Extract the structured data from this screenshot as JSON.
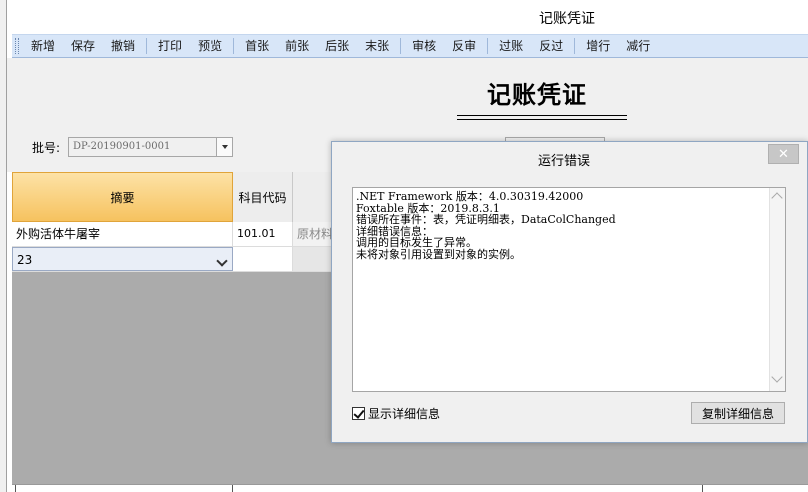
{
  "window": {
    "title": "记账凭证"
  },
  "toolbar": {
    "groups": [
      [
        "新增",
        "保存",
        "撤销"
      ],
      [
        "打印",
        "预览"
      ],
      [
        "首张",
        "前张",
        "后张",
        "末张"
      ],
      [
        "审核",
        "反审"
      ],
      [
        "过账",
        "反过"
      ],
      [
        "增行",
        "减行"
      ]
    ]
  },
  "form": {
    "doc_title": "记账凭证",
    "batch_label": "批号:",
    "batch_value": "DP-20190901-0001"
  },
  "grid": {
    "headers": {
      "summary": "摘要",
      "account_code": "科目代码"
    },
    "rows": [
      {
        "summary": "外购活体牛屠宰",
        "account_code": "101.01",
        "account_name": "原材料料"
      },
      {
        "summary": "23",
        "account_code": "",
        "account_name": ""
      }
    ]
  },
  "dialog": {
    "title": "运行错误",
    "close_symbol": "✕",
    "lines": [
      ".NET Framework 版本：4.0.30319.42000",
      "Foxtable 版本：2019.8.3.1",
      "错误所在事件：表，凭证明细表，DataColChanged",
      "详细错误信息：",
      "调用的目标发生了异常。",
      "未将对象引用设置到对象的实例。"
    ],
    "show_details_label": "显示详细信息",
    "show_details_checked": true,
    "copy_button": "复制详细信息"
  }
}
